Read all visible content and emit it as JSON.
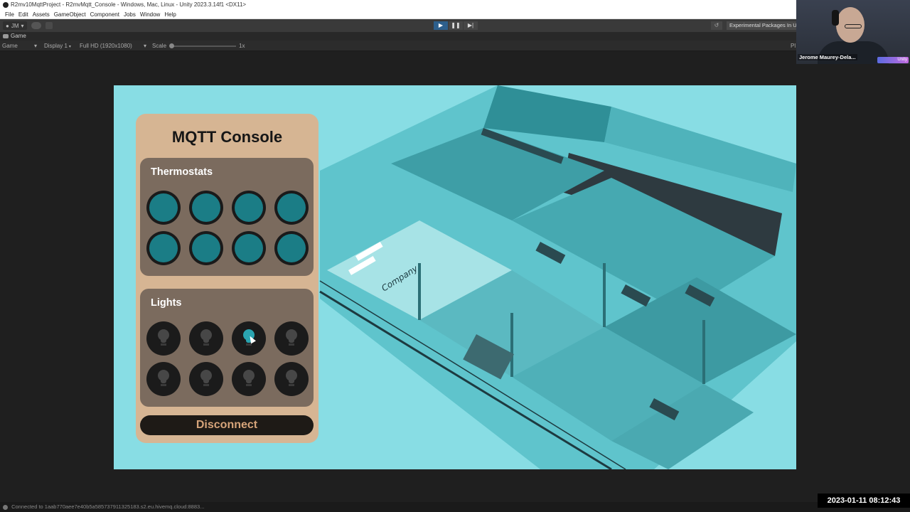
{
  "window": {
    "title": "R2mv10MqttProject - R2mvMqtt_Console - Windows, Mac, Linux - Unity 2023.3.14f1 <DX11>"
  },
  "menu": [
    "File",
    "Edit",
    "Assets",
    "GameObject",
    "Component",
    "Jobs",
    "Window",
    "Help"
  ],
  "toolbar": {
    "account": "JM",
    "play_controls": [
      "play",
      "pause",
      "step"
    ],
    "experimental_label": "Experimental Packages In U"
  },
  "game_tab": {
    "label": "Game"
  },
  "game_bar": {
    "mode": "Game",
    "display": "Display 1",
    "resolution": "Full HD (1920x1080)",
    "scale_label": "Scale",
    "scale_value": "1x",
    "right_label": "Pl"
  },
  "console": {
    "title": "MQTT Console",
    "thermostats": {
      "title": "Thermostats",
      "count": 8
    },
    "lights": {
      "title": "Lights",
      "states": [
        false,
        false,
        true,
        false,
        false,
        false,
        false,
        false
      ]
    },
    "disconnect_label": "Disconnect"
  },
  "scene": {
    "company_sign": "Company"
  },
  "status_bar": {
    "text": "Connected to 1aab770aee7e40b5a585737911325183.s2.eu.hivemq.cloud:8883..."
  },
  "overlay": {
    "timestamp": "2023-01-11  08:12:43",
    "presenter_name": "Jerome Maurey-Dela...",
    "brand": "Unity"
  },
  "colors": {
    "viewport_bg": "#88dde4",
    "panel": "#d6b593",
    "section": "#7b6b5e",
    "thermostat": "#1b7d86",
    "light_on": "#2aa4b0",
    "disconnect_text": "#d6a47a"
  }
}
